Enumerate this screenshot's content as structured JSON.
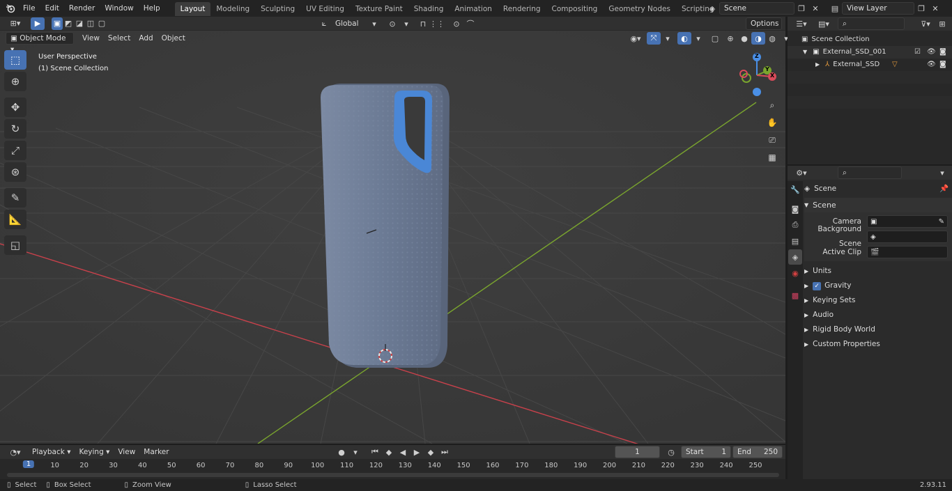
{
  "menu": [
    "File",
    "Edit",
    "Render",
    "Window",
    "Help"
  ],
  "workspaces": [
    "Layout",
    "Modeling",
    "Sculpting",
    "UV Editing",
    "Texture Paint",
    "Shading",
    "Animation",
    "Rendering",
    "Compositing",
    "Geometry Nodes",
    "Scripting"
  ],
  "active_workspace": "Layout",
  "scene_name": "Scene",
  "view_layer": "View Layer",
  "viewport": {
    "mode": "Object Mode",
    "header_menus": [
      "View",
      "Select",
      "Add",
      "Object"
    ],
    "orientation": "Global",
    "options": "Options",
    "overlay_title": "User Perspective",
    "overlay_subtitle": "(1) Scene Collection"
  },
  "gizmo": {
    "z": "Z",
    "y": "Y",
    "x": "X"
  },
  "outliner": {
    "root": "Scene Collection",
    "items": [
      {
        "label": "External_SSD_001",
        "depth": 1
      },
      {
        "label": "External_SSD",
        "depth": 2
      }
    ]
  },
  "properties": {
    "context": "Scene",
    "panel": "Scene",
    "fields": [
      {
        "label": "Camera"
      },
      {
        "label": "Background Scene"
      },
      {
        "label": "Active Clip"
      }
    ],
    "sections": [
      "Units",
      "Gravity",
      "Keying Sets",
      "Audio",
      "Rigid Body World",
      "Custom Properties"
    ],
    "gravity_checked": true
  },
  "timeline": {
    "menus": [
      "Playback",
      "Keying",
      "View",
      "Marker"
    ],
    "current_frame": "1",
    "start_label": "Start",
    "start": "1",
    "end_label": "End",
    "end": "250",
    "ruler": [
      "1",
      "10",
      "20",
      "30",
      "40",
      "50",
      "60",
      "70",
      "80",
      "90",
      "100",
      "110",
      "120",
      "130",
      "140",
      "150",
      "160",
      "170",
      "180",
      "190",
      "200",
      "210",
      "220",
      "230",
      "240",
      "250"
    ]
  },
  "statusbar": {
    "select": "Select",
    "box_select": "Box Select",
    "zoom_view": "Zoom View",
    "lasso_select": "Lasso Select",
    "version": "2.93.11"
  },
  "colors": {
    "accent": "#4772b3",
    "x_axis": "#c8414b",
    "y_axis": "#7aa52e",
    "ssd_body": "#6b7a93",
    "ssd_loop": "#4a87d6"
  }
}
